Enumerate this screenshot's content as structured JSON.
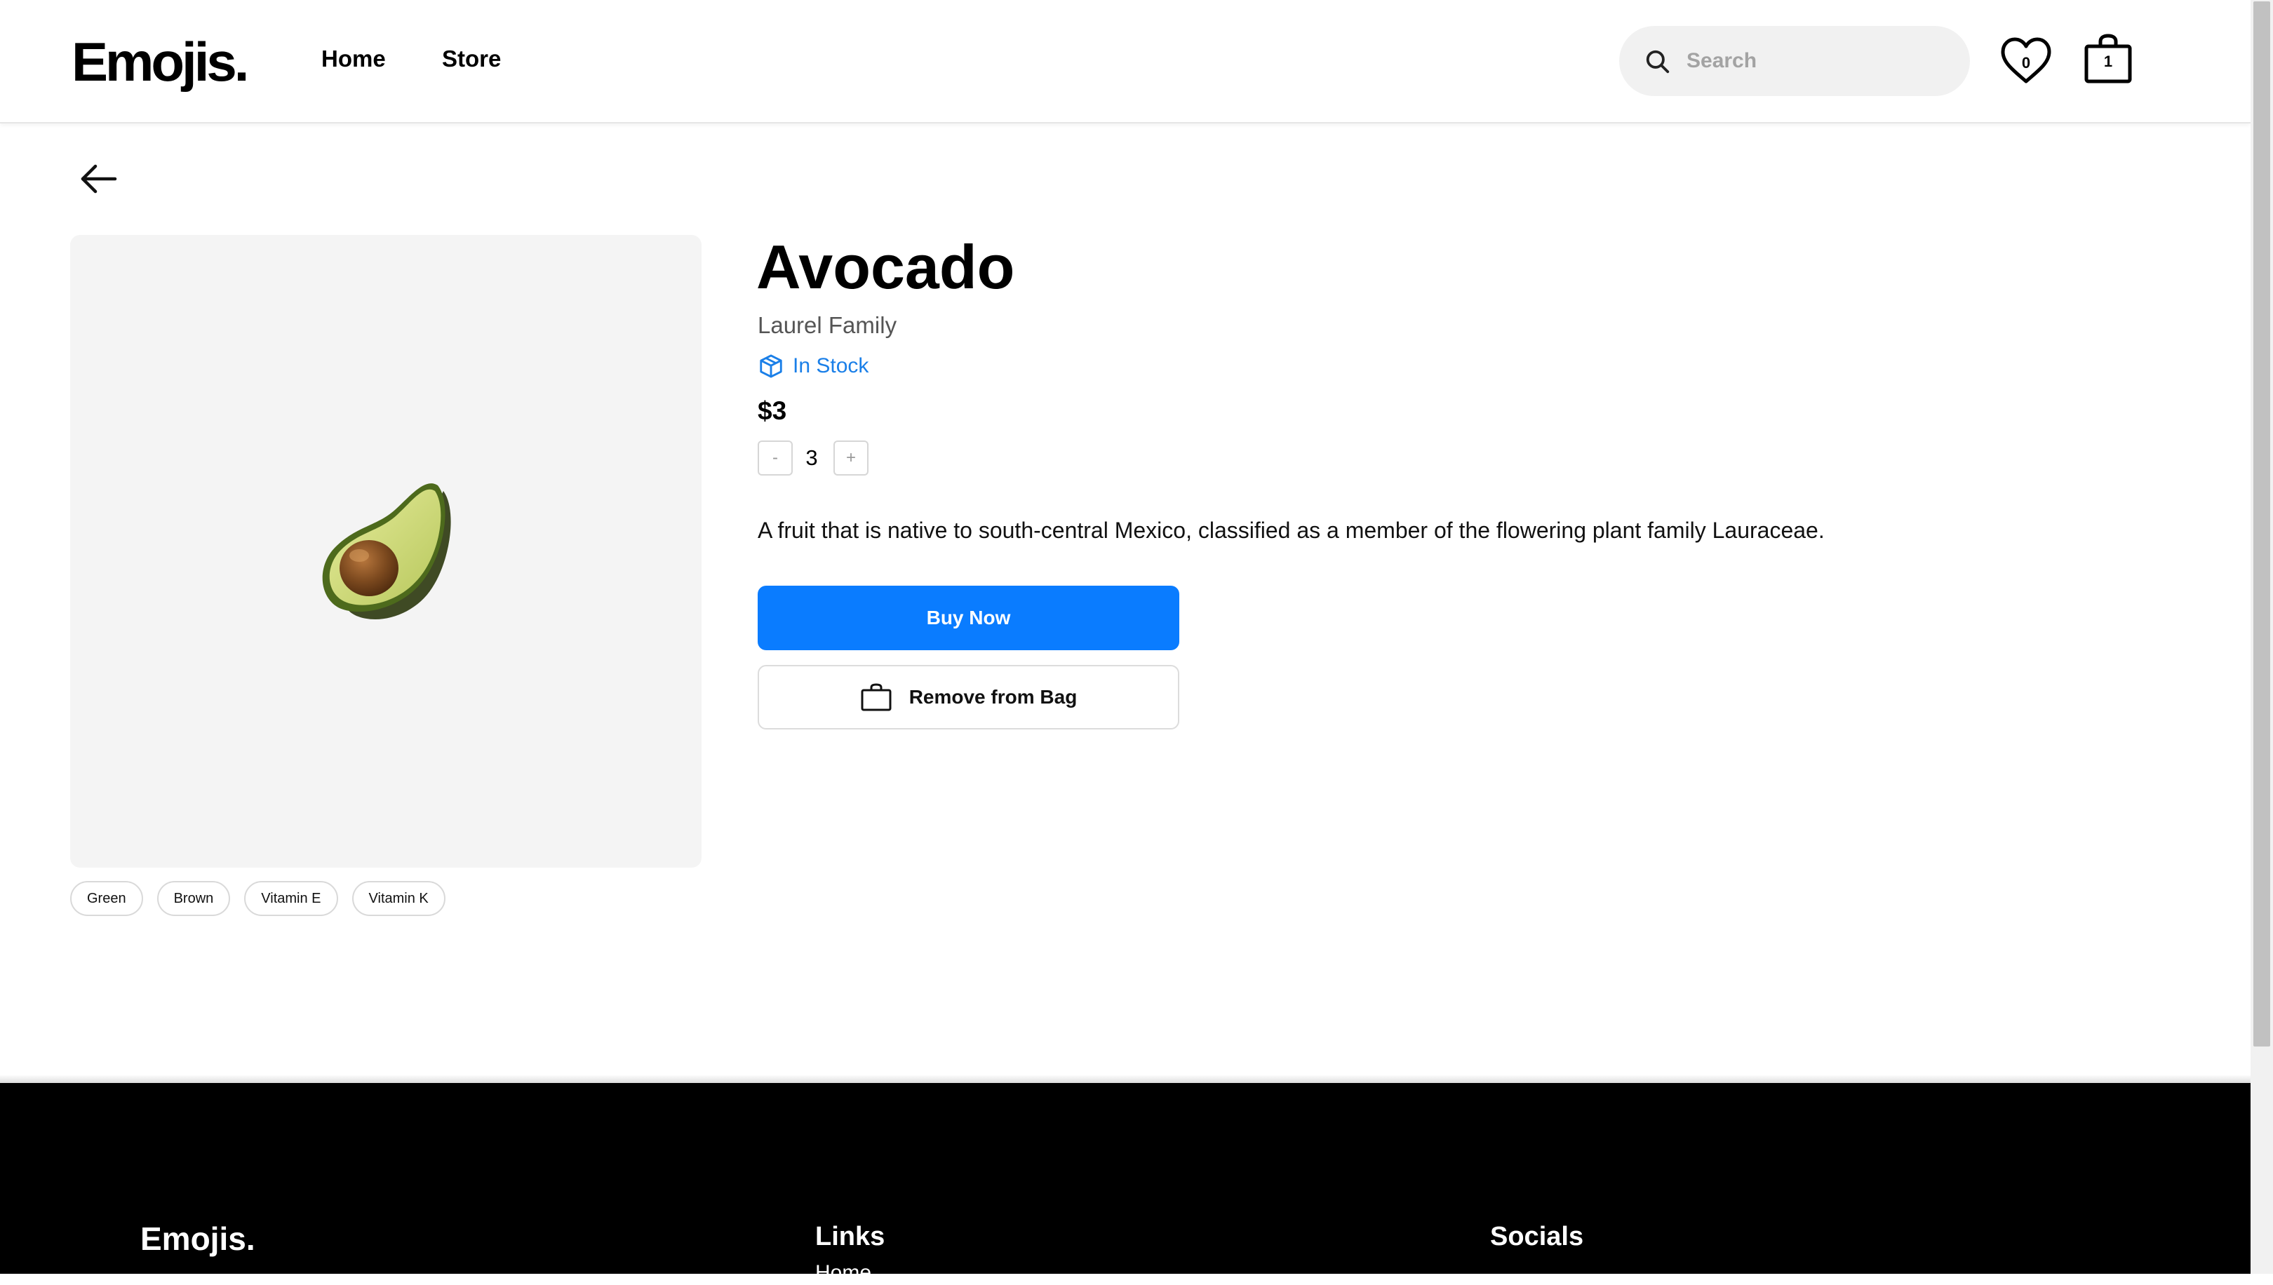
{
  "header": {
    "logo": "Emojis.",
    "nav": {
      "home": "Home",
      "store": "Store"
    },
    "search": {
      "placeholder": "Search",
      "value": ""
    },
    "wishlist_count": "0",
    "bag_count": "1",
    "icons": [
      "search-icon",
      "heart-icon",
      "bag-icon"
    ]
  },
  "back": {
    "icon": "arrow-left-icon"
  },
  "product": {
    "name": "Avocado",
    "family": "Laurel Family",
    "stock": "In Stock",
    "stock_icon": "box-icon",
    "price": "$3",
    "quantity": {
      "minus": "-",
      "value": "3",
      "plus": "+"
    },
    "description": "A fruit that is native to south-central Mexico, classified as a member of the flowering plant family Lauraceae.",
    "emoji": "avocado",
    "tags": [
      "Green",
      "Brown",
      "Vitamin E",
      "Vitamin K"
    ],
    "buy_label": "Buy Now",
    "remove_label": "Remove from Bag"
  },
  "footer": {
    "logo": "Emojis.",
    "links_heading": "Links",
    "socials_heading": "Socials"
  },
  "colors": {
    "accent": "#0a7cff",
    "stock": "#1a7fe8",
    "image_bg": "#f4f4f4",
    "footer_bg": "#000000"
  }
}
